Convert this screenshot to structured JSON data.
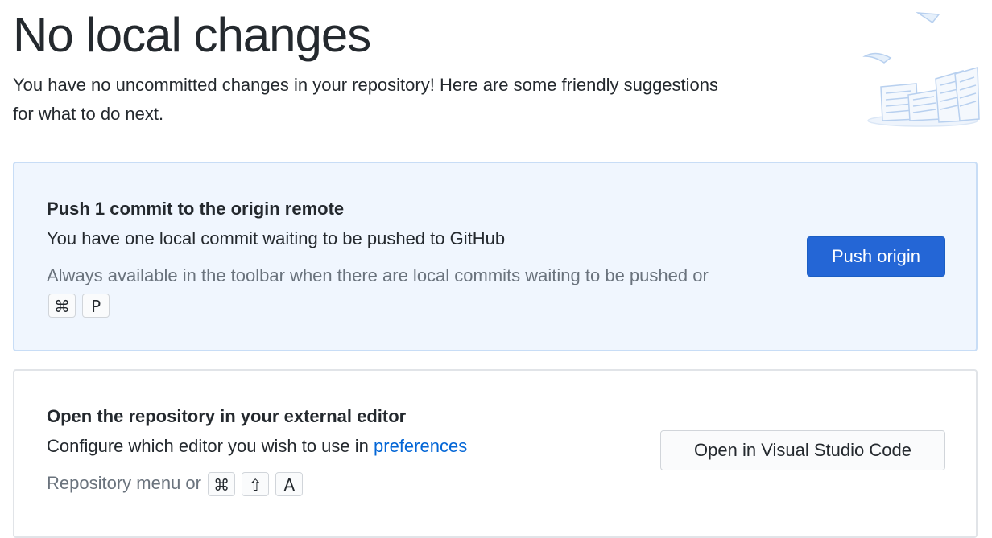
{
  "header": {
    "title": "No local changes",
    "subtitle": "You have no uncommitted changes in your repository! Here are some friendly suggestions for what to do next."
  },
  "illustration": {
    "icon": "papers-illustration-icon"
  },
  "push_card": {
    "title": "Push 1 commit to the origin remote",
    "description": "You have one local commit waiting to be pushed to GitHub",
    "hint_prefix": "Always available in the toolbar when there are local commits waiting to be pushed or",
    "shortcut_keys": [
      "⌘",
      "P"
    ],
    "button_label": "Push origin"
  },
  "editor_card": {
    "title": "Open the repository in your external editor",
    "description_prefix": "Configure which editor you wish to use in",
    "preferences_link": "preferences",
    "hint_prefix": "Repository menu or",
    "shortcut_keys": [
      "⌘",
      "⇧",
      "A"
    ],
    "button_label": "Open in Visual Studio Code"
  },
  "colors": {
    "accent": "#2466d6",
    "push_card_bg": "#f0f6fe",
    "link": "#0366d6"
  }
}
